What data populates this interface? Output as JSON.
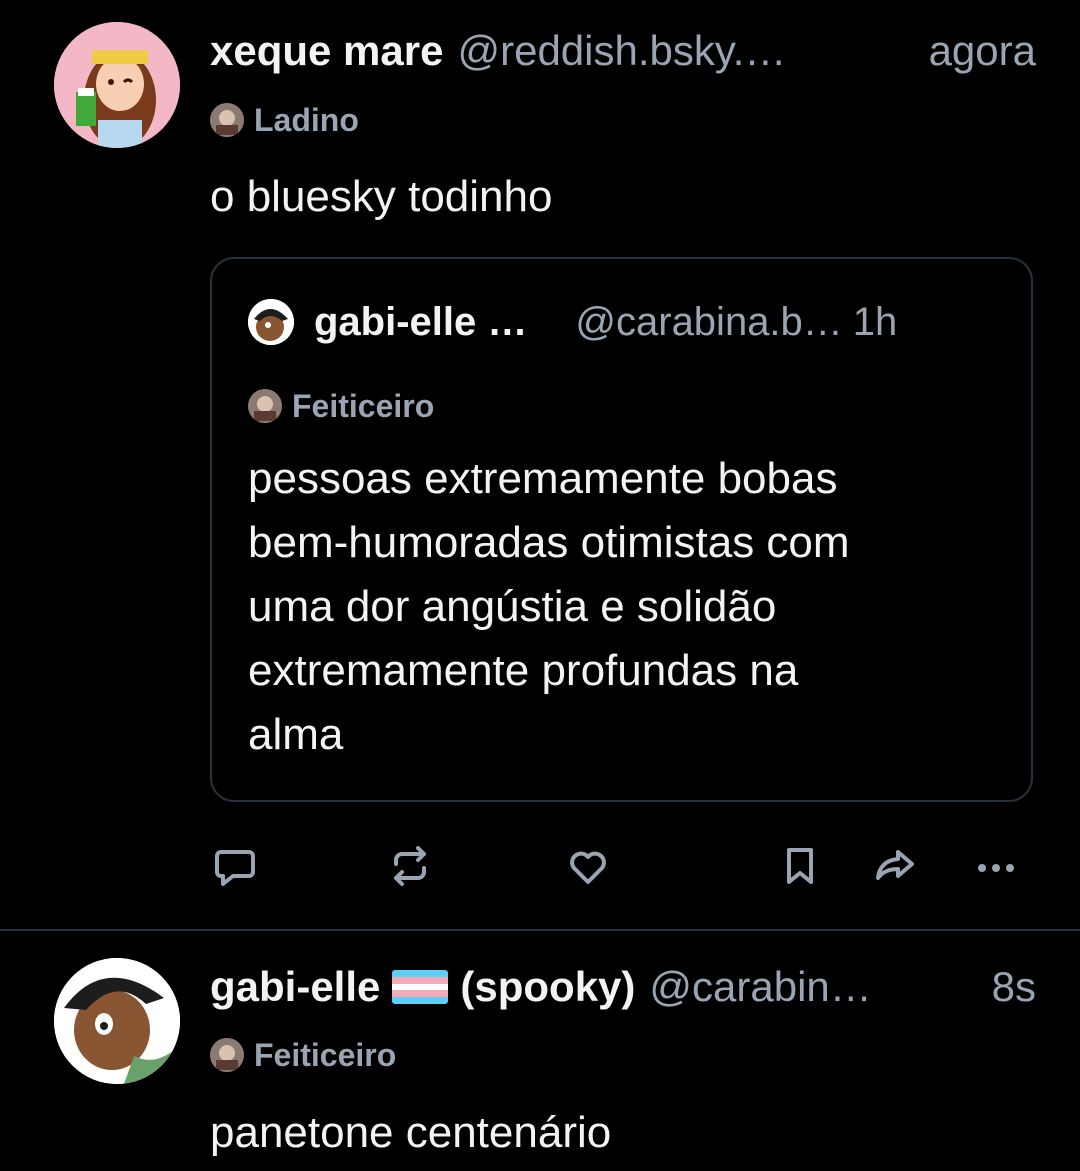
{
  "posts": [
    {
      "author_name": "xeque mare",
      "handle": "@reddish.bsky.…",
      "time": "agora",
      "label": "Ladino",
      "text": "o bluesky todinho",
      "quote": {
        "author_name": "gabi-elle …",
        "handle": "@carabina.b…",
        "time": "1h",
        "label": "Feiticeiro",
        "text_lines": [
          "pessoas extremamente bobas",
          "bem-humoradas otimistas com",
          "uma dor angústia e solidão",
          "extremamente profundas na",
          "alma"
        ]
      },
      "actions": [
        "reply-icon",
        "repost-icon",
        "like-icon",
        "bookmark-icon",
        "share-icon",
        "more-icon"
      ]
    },
    {
      "author_name": "gabi-elle",
      "flag": "trans-flag",
      "author_suffix": "(spooky)",
      "handle": "@carabin…",
      "time": "8s",
      "label": "Feiticeiro",
      "text": "panetone centenário"
    }
  ],
  "colors": {
    "background": "#000000",
    "primary_text": "#f1f3f5",
    "secondary_text": "#9aa4b2",
    "border": "#2a3039",
    "icon": "#9aa4b2"
  }
}
